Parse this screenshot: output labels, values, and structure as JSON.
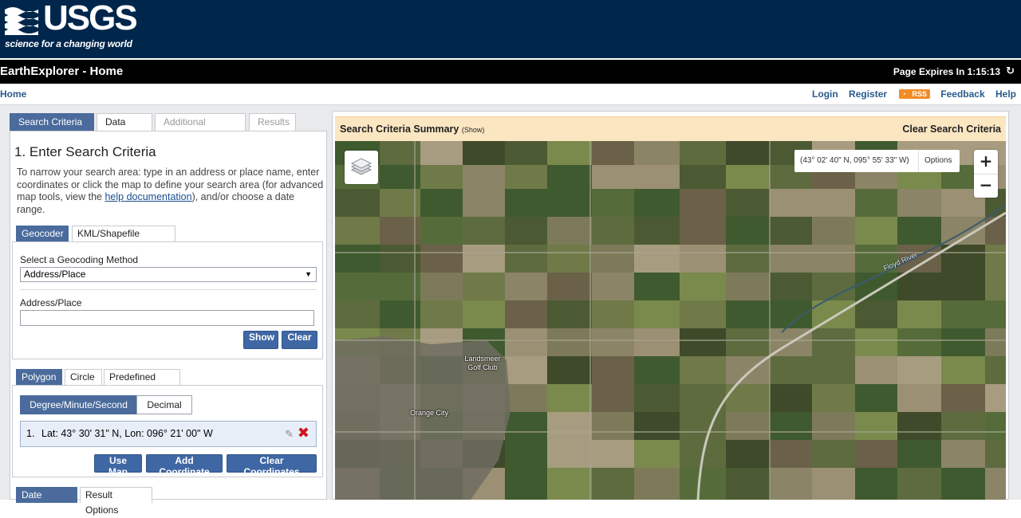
{
  "brand": {
    "logo_text": "USGS",
    "tagline": "science for a changing world"
  },
  "title_bar": {
    "app_title": "EarthExplorer - Home",
    "expires_label": "Page Expires In 1:15:13",
    "refresh_icon": "refresh-icon"
  },
  "nav": {
    "home": "Home",
    "login": "Login",
    "register": "Register",
    "rss": "RSS",
    "feedback": "Feedback",
    "help": "Help"
  },
  "main_tabs": [
    "Search Criteria",
    "Data Sets",
    "Additional Criteria",
    "Results"
  ],
  "search": {
    "heading": "1. Enter Search Criteria",
    "intro_before_link": "To narrow your search area: type in an address or place name, enter coordinates or click the map to define your search area (for advanced map tools, view the ",
    "help_link": "help documentation",
    "intro_after_link": "), and/or choose a date range.",
    "geo_tabs": [
      "Geocoder",
      "KML/Shapefile Upload"
    ],
    "geocoding_method_label": "Select a Geocoding Method",
    "geocoding_method_value": "Address/Place",
    "address_label": "Address/Place",
    "address_value": "",
    "show_button": "Show",
    "clear_button": "Clear",
    "area_tabs": [
      "Polygon",
      "Circle",
      "Predefined Area"
    ],
    "coord_formats": [
      "Degree/Minute/Second",
      "Decimal"
    ],
    "coordinates": [
      {
        "index": "1.",
        "text": "Lat: 43° 30' 31\" N, Lon: 096° 21' 00\" W"
      }
    ],
    "use_map_button": "Use Map",
    "add_coordinate_button": "Add Coordinate",
    "clear_coordinates_button": "Clear Coordinates",
    "bottom_tabs": [
      "Date Range",
      "Result Options"
    ]
  },
  "map_panel": {
    "summary_title": "Search Criteria Summary",
    "summary_show": "(Show)",
    "clear_link": "Clear Search Criteria",
    "coord_readout": "(43° 02' 40\" N, 095° 55' 33\" W)",
    "options_label": "Options",
    "zoom_in": "+",
    "zoom_out": "−",
    "labels": {
      "golf_club": "Landsmeer\nGolf Club",
      "city": "Orange City",
      "river": "Floyd River"
    }
  },
  "colors": {
    "header_bg": "#00264c",
    "accent": "#4a6b9c",
    "button": "#3f67a3",
    "summary_bg": "#fbe6c2"
  }
}
